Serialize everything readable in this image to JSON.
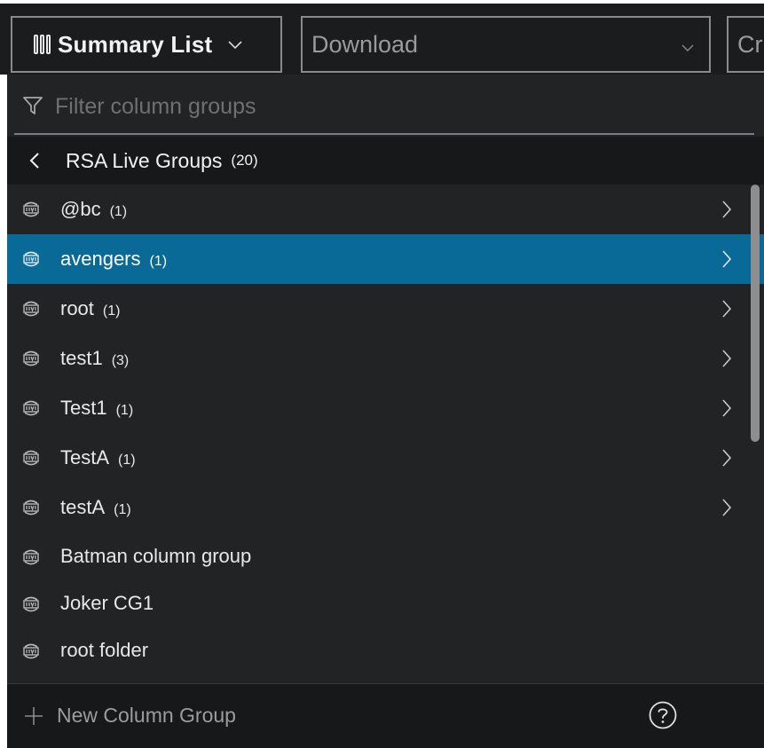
{
  "toolbar": {
    "view_label": "Summary List",
    "download_label": "Download",
    "create_label": "Cr"
  },
  "filter": {
    "placeholder": "Filter column groups",
    "value": ""
  },
  "breadcrumb": {
    "title": "RSA Live Groups",
    "count": "(20)"
  },
  "list": {
    "items": [
      {
        "name": "@bc",
        "count": "(1)",
        "has_children": true,
        "selected": false
      },
      {
        "name": "avengers",
        "count": "(1)",
        "has_children": true,
        "selected": true
      },
      {
        "name": "root",
        "count": "(1)",
        "has_children": true,
        "selected": false
      },
      {
        "name": "test1",
        "count": "(3)",
        "has_children": true,
        "selected": false
      },
      {
        "name": "Test1",
        "count": "(1)",
        "has_children": true,
        "selected": false
      },
      {
        "name": "TestA",
        "count": "(1)",
        "has_children": true,
        "selected": false
      },
      {
        "name": "testA",
        "count": "(1)",
        "has_children": true,
        "selected": false
      },
      {
        "name": "Batman column group",
        "count": "",
        "has_children": false,
        "selected": false
      },
      {
        "name": "Joker CG1",
        "count": "",
        "has_children": false,
        "selected": false
      },
      {
        "name": "root folder",
        "count": "",
        "has_children": false,
        "selected": false
      }
    ]
  },
  "footer": {
    "new_label": "New Column Group"
  },
  "icons": {
    "live": "live-icon",
    "filter": "filter-icon",
    "help": "help-icon",
    "plus": "plus-icon"
  },
  "colors": {
    "panel_bg": "#222325",
    "header_bg": "#17181a",
    "selected_bg": "#0a6a97",
    "text": "#e8e8e8"
  }
}
